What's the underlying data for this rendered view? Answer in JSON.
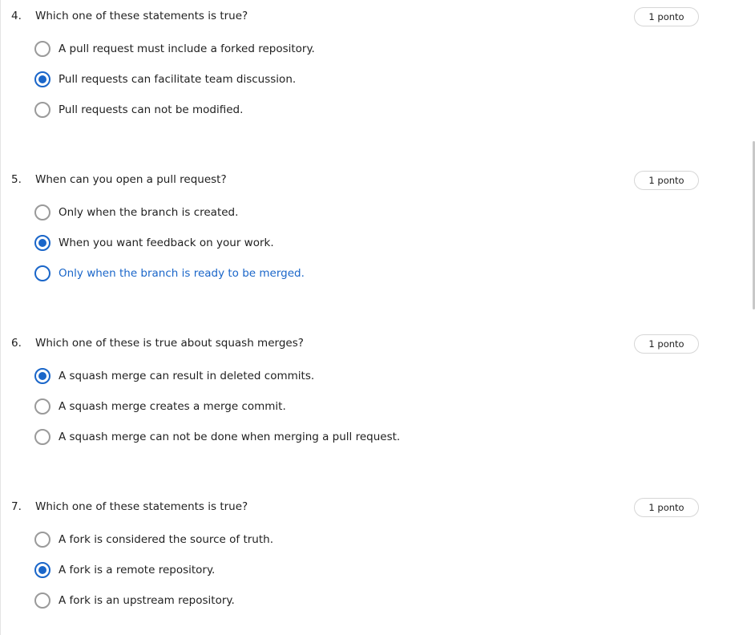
{
  "questions": [
    {
      "number": "4.",
      "text": "Which one of these statements is true?",
      "points": "1 ponto",
      "options": [
        {
          "label": "A pull request must include a forked repository.",
          "selected": false,
          "hover": false
        },
        {
          "label": "Pull requests can facilitate team discussion.",
          "selected": true,
          "hover": false
        },
        {
          "label": "Pull requests can not be modified.",
          "selected": false,
          "hover": false
        }
      ]
    },
    {
      "number": "5.",
      "text": "When can you open a pull request?",
      "points": "1 ponto",
      "options": [
        {
          "label": "Only when the branch is created.",
          "selected": false,
          "hover": false
        },
        {
          "label": "When you want feedback on your work.",
          "selected": true,
          "hover": false
        },
        {
          "label": "Only when the branch is ready to be merged.",
          "selected": false,
          "hover": true
        }
      ]
    },
    {
      "number": "6.",
      "text": "Which one of these is true about squash merges?",
      "points": "1 ponto",
      "options": [
        {
          "label": "A squash merge can result in deleted commits.",
          "selected": true,
          "hover": false
        },
        {
          "label": "A squash merge creates a merge commit.",
          "selected": false,
          "hover": false
        },
        {
          "label": "A squash merge can not be done when merging a pull request.",
          "selected": false,
          "hover": false
        }
      ]
    },
    {
      "number": "7.",
      "text": "Which one of these statements is true?",
      "points": "1 ponto",
      "options": [
        {
          "label": "A fork is considered the source of truth.",
          "selected": false,
          "hover": false
        },
        {
          "label": "A fork is a remote repository.",
          "selected": true,
          "hover": false
        },
        {
          "label": "A fork is an upstream repository.",
          "selected": false,
          "hover": false
        }
      ]
    }
  ],
  "colors": {
    "accent": "#1a66c9",
    "radio_border": "#9a9a9a",
    "text": "#1f1f1f"
  }
}
